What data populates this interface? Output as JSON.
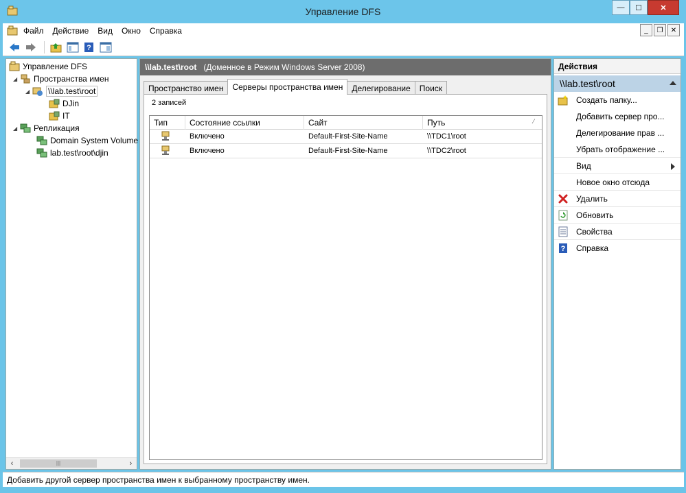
{
  "window": {
    "title": "Управление DFS"
  },
  "menu": {
    "items": [
      "Файл",
      "Действие",
      "Вид",
      "Окно",
      "Справка"
    ]
  },
  "tree": {
    "root": "Управление DFS",
    "namespaces": "Пространства имен",
    "namespace_root": "\\\\lab.test\\root",
    "folders": [
      "DJin",
      "IT"
    ],
    "replication": "Репликация",
    "replication_groups": [
      "Domain System Volume",
      "lab.test\\root\\djin"
    ]
  },
  "center": {
    "header_path": "\\\\lab.test\\root",
    "header_desc": "(Доменное в Режим Windows Server 2008)",
    "tabs": [
      "Пространство имен",
      "Серверы пространства имен",
      "Делегирование",
      "Поиск"
    ],
    "active_tab": 1,
    "record_count": "2 записей",
    "columns": [
      "Тип",
      "Состояние ссылки",
      "Сайт",
      "Путь"
    ],
    "rows": [
      {
        "status": "Включено",
        "site": "Default-First-Site-Name",
        "path": "\\\\TDC1\\root"
      },
      {
        "status": "Включено",
        "site": "Default-First-Site-Name",
        "path": "\\\\TDC2\\root"
      }
    ]
  },
  "actions": {
    "title": "Действия",
    "section": "\\\\lab.test\\root",
    "items": [
      "Создать папку...",
      "Добавить сервер про...",
      "Делегирование прав ...",
      "Убрать отображение ...",
      "Вид",
      "Новое окно отсюда",
      "Удалить",
      "Обновить",
      "Свойства",
      "Справка"
    ]
  },
  "status": {
    "text": "Добавить другой сервер пространства имен к выбранному пространству имен."
  }
}
